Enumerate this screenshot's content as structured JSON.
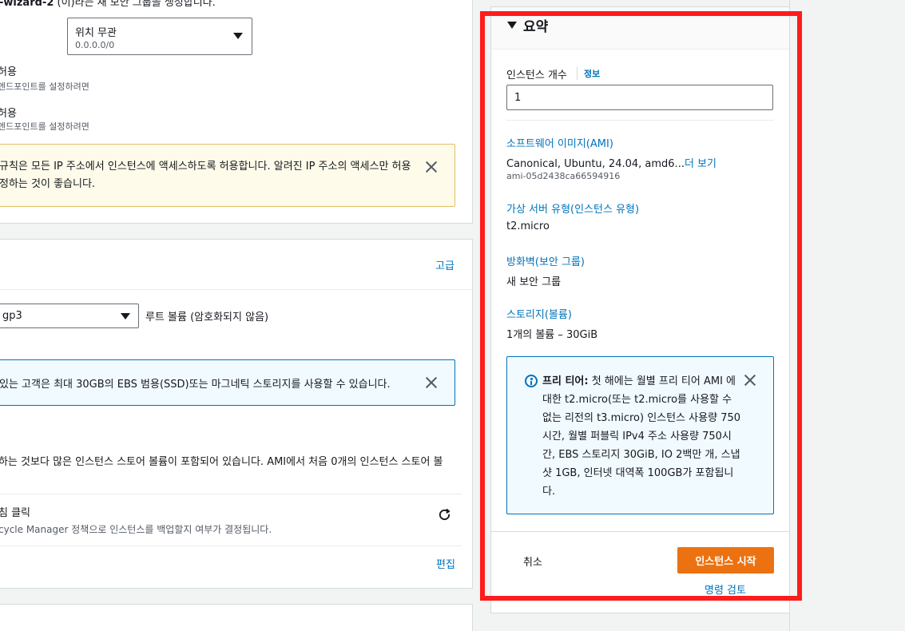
{
  "left": {
    "top_line": {
      "bold": "-wizard-2",
      "rest": "(이)라는 새 보안 그룹을 생성합니다."
    },
    "source_select": {
      "value": "위치 무관",
      "sub": "0.0.0.0/0"
    },
    "allow_https": {
      "label": "허용",
      "desc": "엔드포인트를 설정하려면"
    },
    "allow_http": {
      "label": "허용",
      "desc": "엔드포인트를 설정하려면"
    },
    "warning": {
      "line1": "규칙은 모든 IP 주소에서 인스턴스에 액세스하도록 허용합니다. 알려진 IP 주소의 액세스만 허용",
      "line2": "정하는 것이 좋습니다."
    },
    "storage": {
      "advanced_link": "고급",
      "volume_type": "gp3",
      "root_volume": "루트 볼륨  (암호화되지 않음)",
      "free_tier_info": "있는 고객은 최대 30GB의 EBS 범용(SSD)또는 마그네틱 스토리지를 사용할 수 있습니다.",
      "instance_store_note": "하는 것보다 많은 인스턴스 스토어 볼륨이 포함되어 있습니다. AMI에서 처음 0개의 인스턴스 스토어 볼",
      "backup_title": "침 클릭",
      "backup_desc": "cycle Manager 정책으로 인스턴스를 백업할지 여부가 결정됩니다.",
      "edit_link": "편집"
    }
  },
  "summary": {
    "title": "요약",
    "instance_count_label": "인스턴스 개수",
    "info_link": "정보",
    "instance_count_value": "1",
    "ami_label": "소프트웨어 이미지(AMI)",
    "ami_value": "Canonical, Ubuntu, 24.04, amd6...",
    "ami_more_link": "더 보기",
    "ami_id": "ami-05d2438ca66594916",
    "instance_type_label": "가상 서버 유형(인스턴스 유형)",
    "instance_type_value": "t2.micro",
    "firewall_label": "방화벽(보안 그룹)",
    "firewall_value": "새 보안 그룹",
    "storage_label": "스토리지(볼륨)",
    "storage_value": "1개의 볼륨 – 30GiB",
    "free_tier": {
      "bold": "프리 티어:",
      "text": " 첫 해에는 월별 프리 티어 AMI 에 대한 t2.micro(또는 t2.micro를 사용할 수 없는 리전의 t3.micro) 인스턴스 사용량 750시간, 월별 퍼블릭 IPv4 주소 사용량 750시간, EBS 스토리지 30GiB, IO 2백만 개, 스냅샷 1GB, 인터넷 대역폭 100GB가 포함됩니다."
    },
    "cancel_label": "취소",
    "launch_label": "인스턴스 시작",
    "review_commands_link": "명령 검토"
  },
  "colors": {
    "accent": "#0073bb",
    "launch": "#ec7211",
    "highlight": "#ff1c1c"
  }
}
